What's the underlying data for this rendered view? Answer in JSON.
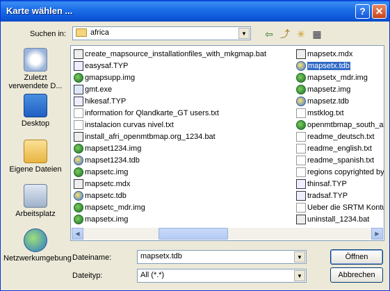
{
  "window": {
    "title": "Karte wählen ...",
    "help_label": "?",
    "close_label": "✕"
  },
  "lookin": {
    "label": "Suchen in:",
    "value": "africa"
  },
  "toolbar": {
    "back": "⇦",
    "up": "⤴",
    "new_folder": "✳",
    "view": "▦"
  },
  "places": [
    {
      "label": "Zuletzt verwendete D..."
    },
    {
      "label": "Desktop"
    },
    {
      "label": "Eigene Dateien"
    },
    {
      "label": "Arbeitsplatz"
    },
    {
      "label": "Netzwerkumgebung"
    }
  ],
  "files_col1": [
    {
      "name": "create_mapsource_installationfiles_with_mkgmap.bat",
      "icon": "bat"
    },
    {
      "name": "easysaf.TYP",
      "icon": "typ"
    },
    {
      "name": "gmapsupp.img",
      "icon": "globe"
    },
    {
      "name": "gmt.exe",
      "icon": "exe"
    },
    {
      "name": "hikesaf.TYP",
      "icon": "typ"
    },
    {
      "name": "information for Qlandkarte_GT users.txt",
      "icon": "txt"
    },
    {
      "name": "instalacion curvas nivel.txt",
      "icon": "txt"
    },
    {
      "name": "install_afri_openmtbmap.org_1234.bat",
      "icon": "bat"
    },
    {
      "name": "mapset1234.img",
      "icon": "globe"
    },
    {
      "name": "mapset1234.tdb",
      "icon": "tdb"
    },
    {
      "name": "mapsetc.img",
      "icon": "globe"
    },
    {
      "name": "mapsetc.mdx",
      "icon": "bat"
    },
    {
      "name": "mapsetc.tdb",
      "icon": "tdb"
    },
    {
      "name": "mapsetc_mdr.img",
      "icon": "globe"
    },
    {
      "name": "mapsetx.img",
      "icon": "globe"
    }
  ],
  "files_col2": [
    {
      "name": "mapsetx.mdx",
      "icon": "bat"
    },
    {
      "name": "mapsetx.tdb",
      "icon": "tdb",
      "selected": true
    },
    {
      "name": "mapsetx_mdr.img",
      "icon": "globe"
    },
    {
      "name": "mapsetz.img",
      "icon": "globe"
    },
    {
      "name": "mapsetz.tdb",
      "icon": "tdb"
    },
    {
      "name": "mstklog.txt",
      "icon": "txt"
    },
    {
      "name": "openmtbmap_south_af",
      "icon": "globe"
    },
    {
      "name": "readme_deutsch.txt",
      "icon": "txt"
    },
    {
      "name": "readme_english.txt",
      "icon": "txt"
    },
    {
      "name": "readme_spanish.txt",
      "icon": "txt"
    },
    {
      "name": "regions copyrighted by",
      "icon": "txt"
    },
    {
      "name": "thinsaf.TYP",
      "icon": "typ"
    },
    {
      "name": "tradsaf.TYP",
      "icon": "typ"
    },
    {
      "name": "Ueber die SRTM Kontur",
      "icon": "txt"
    },
    {
      "name": "uninstall_1234.bat",
      "icon": "bat"
    }
  ],
  "filename": {
    "label": "Dateiname:",
    "value": "mapsetx.tdb"
  },
  "filetype": {
    "label": "Dateityp:",
    "value": "All (*.*)"
  },
  "buttons": {
    "open": "Öffnen",
    "cancel": "Abbrechen"
  },
  "scroll": {
    "left": "◀",
    "right": "▶"
  }
}
